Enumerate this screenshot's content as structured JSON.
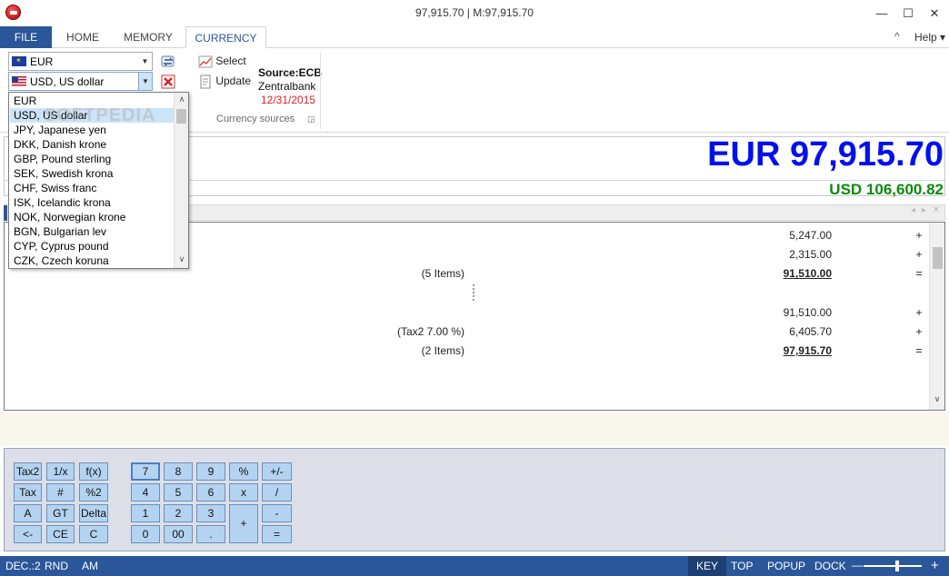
{
  "window": {
    "title": "97,915.70 | M:97,915.70",
    "minimize": "—",
    "maximize": "☐",
    "close": "✕"
  },
  "tabs": {
    "file": "FILE",
    "home": "HOME",
    "memory": "MEMORY",
    "currency": "CURRENCY",
    "collapse": "^",
    "help": "Help ▾"
  },
  "ribbon": {
    "from_currency": "EUR",
    "to_currency": "USD, US dollar",
    "select_label": "Select",
    "update_label": "Update",
    "source_name": "Source:ECB",
    "source_name2": "Zentralbank",
    "source_date": "12/31/2015",
    "group_label": "Currency sources"
  },
  "dropdown": {
    "items": [
      "EUR",
      "USD, US dollar",
      "JPY, Japanese yen",
      "DKK, Danish krone",
      "GBP, Pound sterling",
      "SEK, Swedish krona",
      "CHF, Swiss franc",
      "ISK, Icelandic krona",
      "NOK, Norwegian krone",
      "BGN, Bulgarian lev",
      "CYP, Cyprus pound",
      "CZK, Czech koruna"
    ],
    "selected": "USD, US dollar"
  },
  "display": {
    "main": "EUR 97,915.70",
    "secondary": "USD 106,600.82"
  },
  "tape": {
    "rows": [
      {
        "desc": "",
        "amount": "5,247.00",
        "op": "+",
        "total": false
      },
      {
        "desc": "",
        "amount": "2,315.00",
        "op": "+",
        "total": false
      },
      {
        "desc": "(5 Items)",
        "amount": "91,510.00",
        "op": "=",
        "total": true
      },
      {
        "desc": "",
        "amount": "",
        "op": "",
        "total": false
      },
      {
        "desc": "",
        "amount": "91,510.00",
        "op": "+",
        "total": false
      },
      {
        "desc": "(Tax2 7.00 %)",
        "amount": "6,405.70",
        "op": "+",
        "total": false
      },
      {
        "desc": "(2 Items)",
        "amount": "97,915.70",
        "op": "=",
        "total": true
      }
    ]
  },
  "keypad": {
    "func_keys": [
      [
        "Tax2",
        "1/x",
        "f(x)"
      ],
      [
        "Tax",
        "#",
        "%2"
      ],
      [
        "A",
        "GT",
        "Delta"
      ],
      [
        "<-",
        "CE",
        "C"
      ]
    ],
    "num_keys": [
      [
        "7",
        "8",
        "9",
        "%",
        "+/-"
      ],
      [
        "4",
        "5",
        "6",
        "x",
        "/"
      ],
      [
        "1",
        "2",
        "3",
        "",
        "-"
      ],
      [
        "0",
        "00",
        ".",
        "",
        "="
      ]
    ],
    "plus": "+"
  },
  "status": {
    "dec": "DEC.:2",
    "rnd": "RND",
    "am": "AM",
    "key": "KEY",
    "top": "TOP",
    "popup": "POPUP",
    "dock": "DOCK",
    "zoom_minus": "—",
    "zoom_plus": "+"
  }
}
